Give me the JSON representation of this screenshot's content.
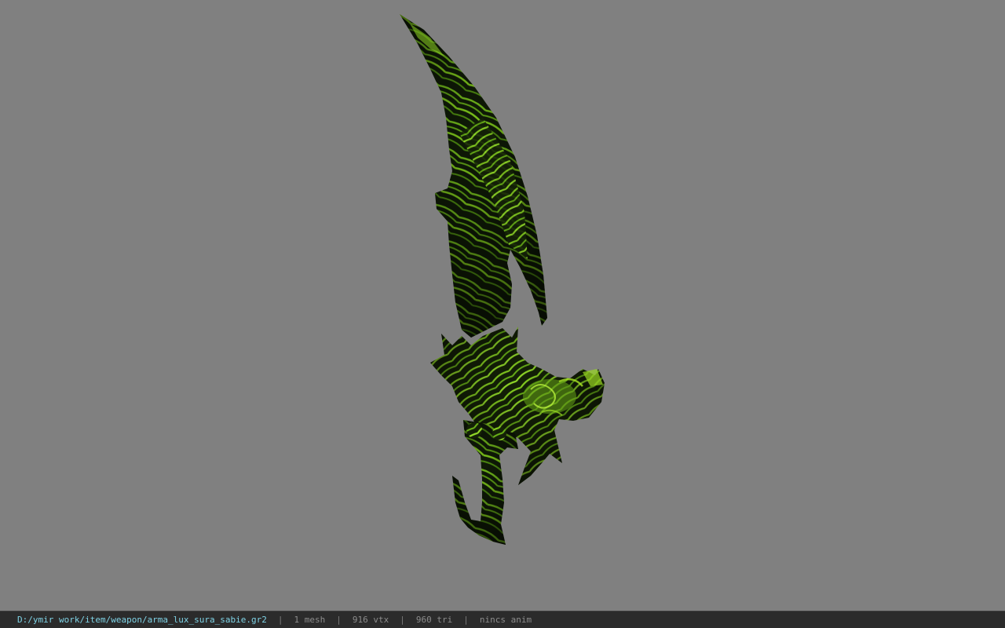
{
  "viewer": {
    "background_color": "#808080",
    "model": {
      "name": "sword-model",
      "base_color": "#0d1806",
      "stripe_color": "#7bc21a",
      "highlight_color": "#a6e224"
    }
  },
  "status_bar": {
    "file_path": "D:/ymir work/item/weapon/arma_lux_sura_sabie.gr2",
    "separator": "|",
    "mesh_count": "1 mesh",
    "vertex_count": "916 vtx",
    "triangle_count": "960 tri",
    "animation": "nincs anim"
  }
}
